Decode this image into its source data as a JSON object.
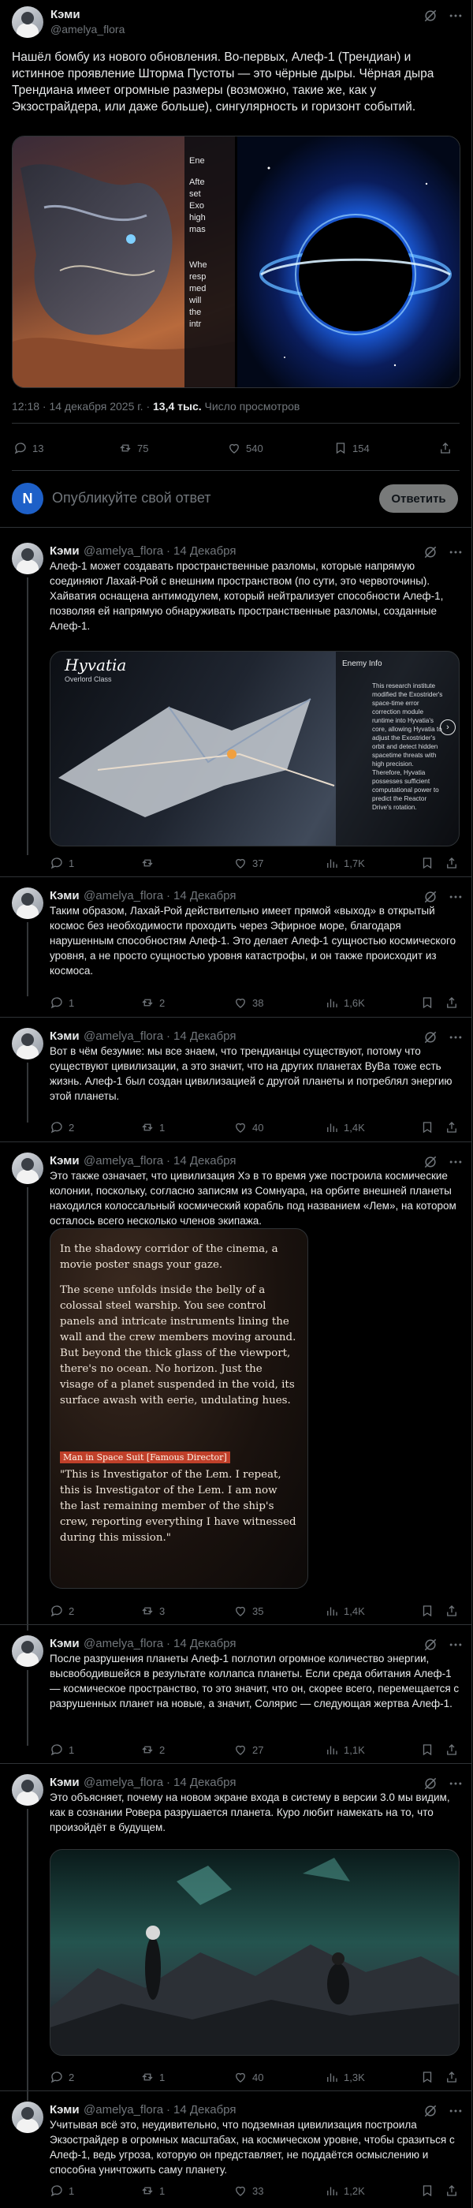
{
  "main_post": {
    "name": "Кэми",
    "handle": "@amelya_flora",
    "text": "Нашёл бомбу из нового обновления. Во-первых, Алеф-1 (Трендиан) и истинное проявление Шторма Пустоты — это чёрные дыры. Чёрная дыра Трендиана имеет огромные размеры (возможно, такие же, как у Экзострайдера, или даже больше), сингулярность и горизонт событий.",
    "image_left_text": [
      "Ene",
      "Afte",
      "set",
      "Exo",
      "high",
      "mas",
      "",
      "Whe",
      "resp",
      "med",
      "will",
      "the",
      "intr"
    ],
    "time": "12:18 · 14 декабря 2025 г. ·",
    "views_count": "13,4 тыс.",
    "views_label": "Число просмотров",
    "replies": "13",
    "reposts": "75",
    "likes": "540",
    "bookmarks": "154"
  },
  "reply_box": {
    "avatar_letter": "N",
    "placeholder": "Опубликуйте свой ответ",
    "button": "Ответить"
  },
  "colors": {
    "accent": "#1d9bf0",
    "avatar_n": "#1e60c8"
  },
  "replies": [
    {
      "name": "Кэми",
      "handle": "@amelya_flora",
      "date": "14 Декабря",
      "text": "Алеф-1 может создавать пространственные разломы, которые напрямую соединяют Лахай-Рой с внешним пространством (по сути, это червоточины). Хайватия оснащена антимодулем, который нейтрализует способности Алеф-1, позволяя ей напрямую обнаруживать пространственные разломы, созданные Алеф-1.",
      "replies": "1",
      "reposts": "",
      "likes": "37",
      "views": "1,7K",
      "card": {
        "title": "Hyvatia",
        "subtitle": "Overlord Class",
        "panel_title": "Enemy Info",
        "panel_text": "This research institute modified the Exostrider's space-time error correction module runtime into Hyvatia's core, allowing Hyvatia to adjust the Exostrider's orbit and detect hidden spacetime threats with high precision. Therefore, Hyvatia possesses sufficient computational power to predict the Reactor Drive's rotation."
      }
    },
    {
      "name": "Кэми",
      "handle": "@amelya_flora",
      "date": "14 Декабря",
      "text": "Таким образом, Лахай-Рой действительно имеет прямой «выход» в открытый космос без необходимости проходить через Эфирное море, благодаря нарушенным способностям Алеф-1. Это делает Алеф-1 сущностью космического уровня, а не просто сущностью уровня катастрофы, и он также происходит из космоса.",
      "replies": "1",
      "reposts": "2",
      "likes": "38",
      "views": "1,6K"
    },
    {
      "name": "Кэми",
      "handle": "@amelya_flora",
      "date": "14 Декабря",
      "text": "Вот в чём безумие: мы все знаем, что трендианцы существуют, потому что существуют цивилизации, а это значит, что на других планетах ВуВа тоже есть жизнь. Алеф-1 был создан цивилизацией с другой планеты и потреблял энергию этой планеты.",
      "replies": "2",
      "reposts": "1",
      "likes": "40",
      "views": "1,4K"
    },
    {
      "name": "Кэми",
      "handle": "@amelya_flora",
      "date": "14 Декабря",
      "text": "Это также означает, что цивилизация Хэ в то время уже построила космические колонии, поскольку, согласно записям из Сомнуара, на орбите внешней планеты находился колоссальный космический корабль под названием «Лем», на котором осталось всего несколько членов экипажа.",
      "replies": "2",
      "reposts": "3",
      "likes": "35",
      "views": "1,4K",
      "story": {
        "p1": "In the shadowy corridor of the cinema, a movie poster snags your gaze.",
        "p2": "The scene unfolds inside the belly of a colossal steel warship. You see control panels and intricate instruments lining the wall and the crew members moving around. But beyond the thick glass of the viewport, there's no ocean. No horizon. Just the visage of a planet suspended in the void, its surface awash with eerie, undulating hues.",
        "speaker": "Man in Space Suit [Famous Director]",
        "quote": "\"This is Investigator of the Lem. I repeat, this is Investigator of the Lem. I am now the last remaining member of the ship's crew, reporting everything I have witnessed during this mission.\""
      }
    },
    {
      "name": "Кэми",
      "handle": "@amelya_flora",
      "date": "14 Декабря",
      "text": "После разрушения планеты Алеф-1 поглотил огромное количество энергии, высвободившейся в результате коллапса планеты. Если среда обитания Алеф-1 — космическое пространство, то это значит, что он, скорее всего, перемещается с разрушенных планет на новые, а значит, Солярис — следующая жертва Алеф-1.",
      "replies": "1",
      "reposts": "2",
      "likes": "27",
      "views": "1,1K"
    },
    {
      "name": "Кэми",
      "handle": "@amelya_flora",
      "date": "14 Декабря",
      "text": "Это объясняет, почему на новом экране входа в систему в версии 3.0 мы видим, как в сознании Ровера разрушается планета. Куро любит намекать на то, что произойдёт в будущем.",
      "replies": "2",
      "reposts": "1",
      "likes": "40",
      "views": "1,3K"
    },
    {
      "name": "Кэми",
      "handle": "@amelya_flora",
      "date": "14 Декабря",
      "text": "Учитывая всё это, неудивительно, что подземная цивилизация построила Экзострайдер в огромных масштабах, на космическом уровне, чтобы сразиться с Алеф-1, ведь угроза, которую он представляет, не поддаётся осмыслению и способна уничтожить саму планету.",
      "replies": "1",
      "reposts": "1",
      "likes": "33",
      "views": "1,2K"
    }
  ]
}
